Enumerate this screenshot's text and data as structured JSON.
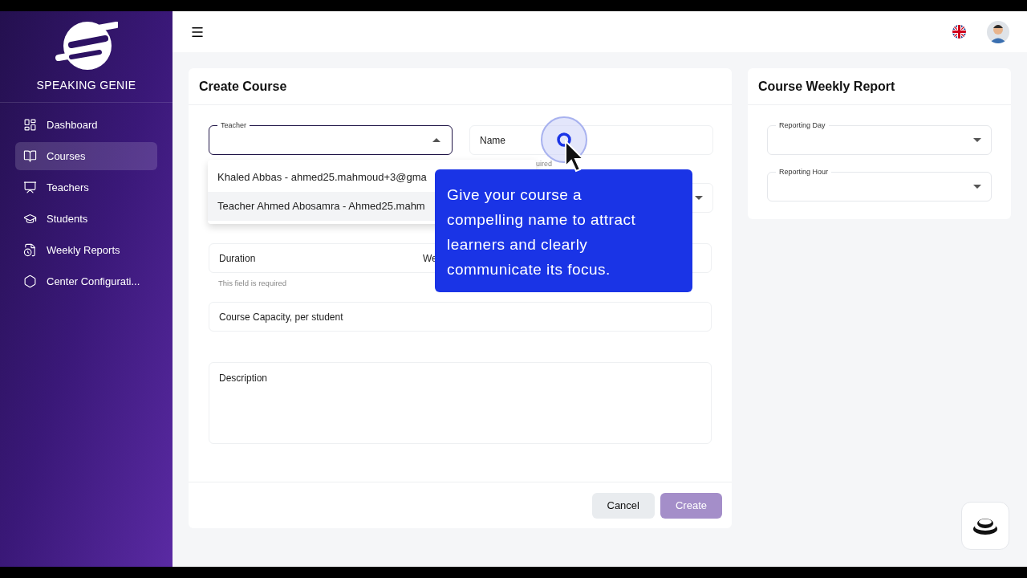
{
  "sidebar": {
    "brand": "SPEAKING GENIE",
    "items": [
      {
        "label": "Dashboard",
        "selected": false
      },
      {
        "label": "Courses",
        "selected": true
      },
      {
        "label": "Teachers",
        "selected": false
      },
      {
        "label": "Students",
        "selected": false
      },
      {
        "label": "Weekly Reports",
        "selected": false
      },
      {
        "label": "Center Configurati...",
        "selected": false
      }
    ]
  },
  "form": {
    "title": "Create Course",
    "teacher": {
      "label": "Teacher",
      "focused": true,
      "menu": [
        {
          "label": "Khaled Abbas - ahmed25.mahmoud+3@gma",
          "selected": false
        },
        {
          "label": "Teacher Ahmed Abosamra - Ahmed25.mahm",
          "selected": true
        }
      ]
    },
    "name": {
      "label": "Name",
      "helper": "uired"
    },
    "duration": {
      "label": "Duration",
      "label_2": "We",
      "helper": "This field is required"
    },
    "capacity": {
      "label": "Course Capacity, per student"
    },
    "description": {
      "label": "Description"
    },
    "buttons": [
      {
        "label": "Cancel",
        "kind": "secondary",
        "disabled": false
      },
      {
        "label": "Create",
        "kind": "primary",
        "disabled": true
      }
    ]
  },
  "tooltip": {
    "text": "Give your course a compelling name to attract learners and clearly communicate its focus."
  },
  "report": {
    "title": "Course Weekly Report",
    "fields": [
      {
        "label": "Reporting Day"
      },
      {
        "label": "Reporting Hour"
      }
    ]
  }
}
